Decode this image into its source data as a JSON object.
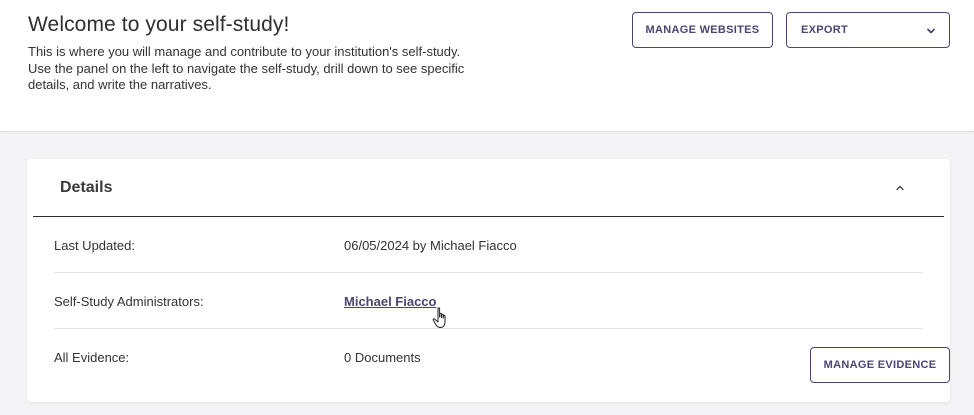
{
  "header": {
    "title": "Welcome to your self-study!",
    "intro_line1": "This is where you will manage and contribute to your institution's self-study.",
    "intro_line2": "Use the panel on the left to navigate the self-study, drill down to see specific",
    "intro_line3": "details, and write the narratives.",
    "manage_websites_label": "MANAGE WEBSITES",
    "export_label": "EXPORT"
  },
  "details": {
    "title": "Details",
    "rows": [
      {
        "label": "Last Updated:",
        "value": "06/05/2024 by Michael Fiacco"
      },
      {
        "label": "Self-Study Administrators:",
        "value": "Michael Fiacco"
      },
      {
        "label": "All Evidence:",
        "value": "0 Documents"
      }
    ],
    "manage_evidence_label": "MANAGE EVIDENCE"
  },
  "colors": {
    "accent": "#4a4673",
    "background": "#f4f4f6",
    "card": "#ffffff"
  },
  "icons": {
    "export_dropdown": "chevron-down-icon",
    "collapse": "chevron-up-icon",
    "pointer": "hand-pointer-cursor-icon"
  }
}
